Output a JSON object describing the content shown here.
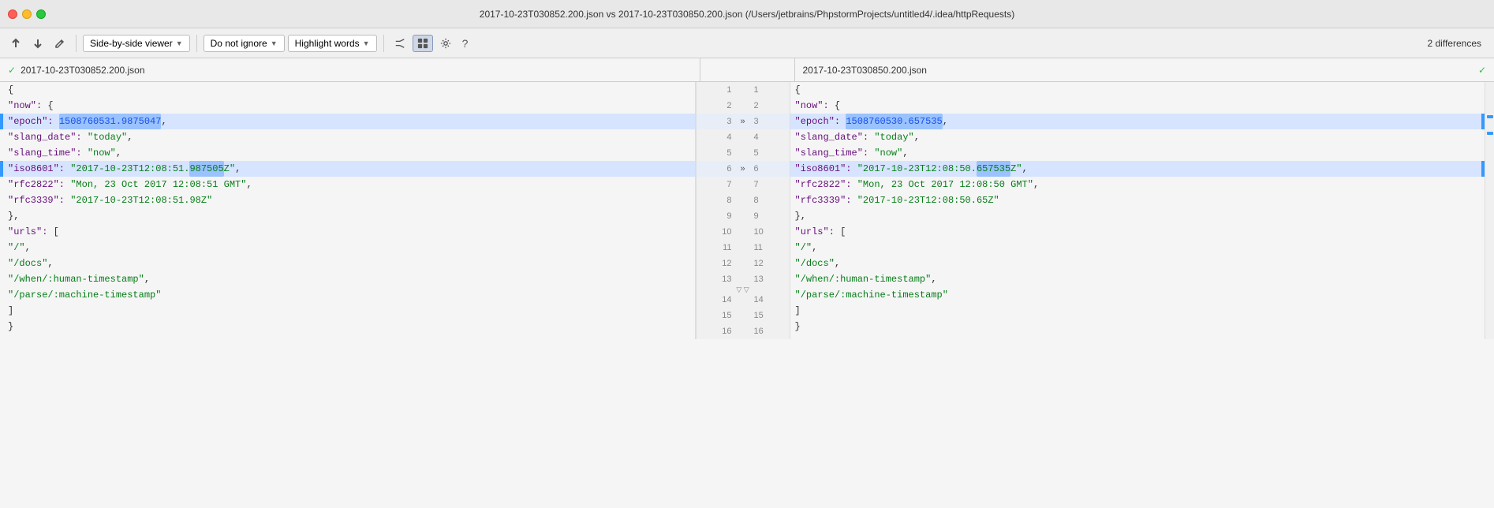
{
  "titlebar": {
    "title": "2017-10-23T030852.200.json vs 2017-10-23T030850.200.json (/Users/jetbrains/PhpstormProjects/untitled4/.idea/httpRequests)"
  },
  "toolbar": {
    "up_label": "↑",
    "down_label": "↓",
    "edit_label": "✎",
    "viewer_label": "Side-by-side viewer",
    "ignore_label": "Do not ignore",
    "highlight_label": "Highlight words",
    "diff_count": "2 differences"
  },
  "files": {
    "left_name": "2017-10-23T030852.200.json",
    "right_name": "2017-10-23T030850.200.json"
  },
  "left_lines": [
    {
      "num": 1,
      "content": "{",
      "changed": false,
      "marker": "check"
    },
    {
      "num": 2,
      "content": "  \"now\": {",
      "changed": false
    },
    {
      "num": 3,
      "content": "    \"epoch\": 1508760531.9875047,",
      "changed": true,
      "arrow": "»"
    },
    {
      "num": 4,
      "content": "    \"slang_date\": \"today\",",
      "changed": false
    },
    {
      "num": 5,
      "content": "    \"slang_time\": \"now\",",
      "changed": false
    },
    {
      "num": 6,
      "content": "    \"iso8601\": \"2017-10-23T12:08:51.987505Z\",",
      "changed": true,
      "arrow": "»"
    },
    {
      "num": 7,
      "content": "    \"rfc2822\": \"Mon, 23 Oct 2017 12:08:51 GMT\",",
      "changed": false
    },
    {
      "num": 8,
      "content": "    \"rfc3339\": \"2017-10-23T12:08:51.98Z\"",
      "changed": false
    },
    {
      "num": 9,
      "content": "  },",
      "changed": false
    },
    {
      "num": 10,
      "content": "  \"urls\": [",
      "changed": false
    },
    {
      "num": 11,
      "content": "    \"/\",",
      "changed": false
    },
    {
      "num": 12,
      "content": "    \"/docs\",",
      "changed": false
    },
    {
      "num": 13,
      "content": "    \"/when/:human-timestamp\",",
      "changed": false
    },
    {
      "num": 14,
      "content": "    \"/parse/:machine-timestamp\"",
      "changed": false
    },
    {
      "num": 15,
      "content": "  ]",
      "changed": false
    },
    {
      "num": 16,
      "content": "}",
      "changed": false
    }
  ],
  "right_lines": [
    {
      "num": 1,
      "content": "{",
      "changed": false,
      "marker": "check"
    },
    {
      "num": 2,
      "content": "  \"now\": {",
      "changed": false
    },
    {
      "num": 3,
      "content": "    \"epoch\": 1508760530.657535,",
      "changed": true,
      "arrow": "«"
    },
    {
      "num": 4,
      "content": "    \"slang_date\": \"today\",",
      "changed": false
    },
    {
      "num": 5,
      "content": "    \"slang_time\": \"now\",",
      "changed": false
    },
    {
      "num": 6,
      "content": "    \"iso8601\": \"2017-10-23T12:08:50.657535Z\",",
      "changed": true,
      "arrow": "«"
    },
    {
      "num": 7,
      "content": "    \"rfc2822\": \"Mon, 23 Oct 2017 12:08:50 GMT\",",
      "changed": false
    },
    {
      "num": 8,
      "content": "    \"rfc3339\": \"2017-10-23T12:08:50.65Z\"",
      "changed": false
    },
    {
      "num": 9,
      "content": "  },",
      "changed": false
    },
    {
      "num": 10,
      "content": "  \"urls\": [",
      "changed": false
    },
    {
      "num": 11,
      "content": "    \"/\",",
      "changed": false
    },
    {
      "num": 12,
      "content": "    \"/docs\",",
      "changed": false
    },
    {
      "num": 13,
      "content": "    \"/when/:human-timestamp\",",
      "changed": false
    },
    {
      "num": 14,
      "content": "    \"/parse/:machine-timestamp\"",
      "changed": false
    },
    {
      "num": 15,
      "content": "  ]",
      "changed": false
    },
    {
      "num": 16,
      "content": "}",
      "changed": false
    }
  ]
}
